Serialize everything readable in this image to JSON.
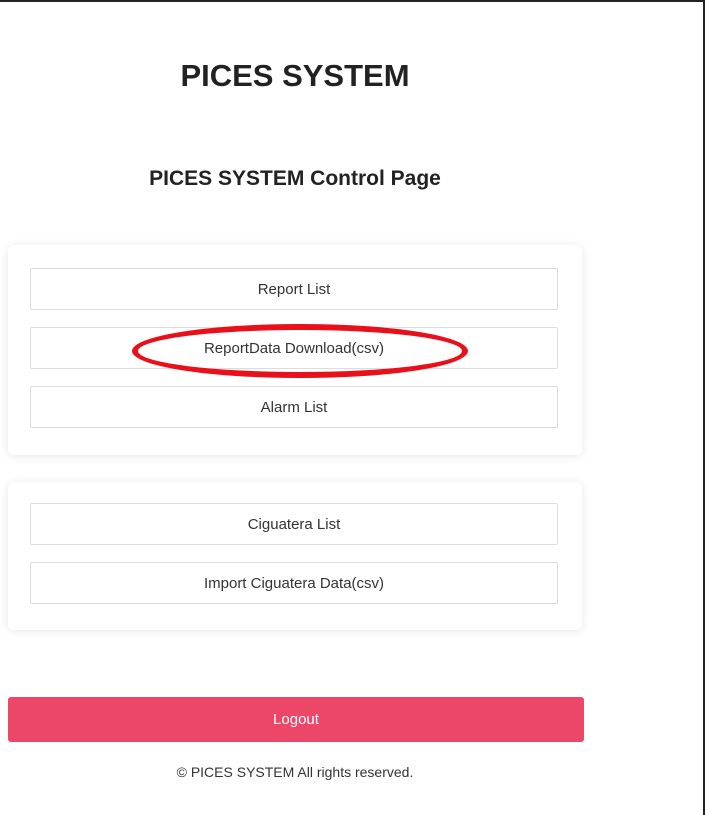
{
  "header": {
    "app_title": "PICES SYSTEM",
    "page_subtitle": "PICES SYSTEM Control Page"
  },
  "report_menu": {
    "items": [
      {
        "label": "Report List"
      },
      {
        "label": "ReportData Download(csv)"
      },
      {
        "label": "Alarm List"
      }
    ]
  },
  "ciguatera_menu": {
    "items": [
      {
        "label": "Ciguatera List"
      },
      {
        "label": "Import Ciguatera Data(csv)"
      }
    ]
  },
  "logout": {
    "label": "Logout"
  },
  "footer": {
    "copyright": "© PICES SYSTEM All rights reserved."
  },
  "colors": {
    "logout_background": "#ec4768",
    "annotation_ellipse": "#e8111b",
    "card_background": "#ffffff"
  }
}
